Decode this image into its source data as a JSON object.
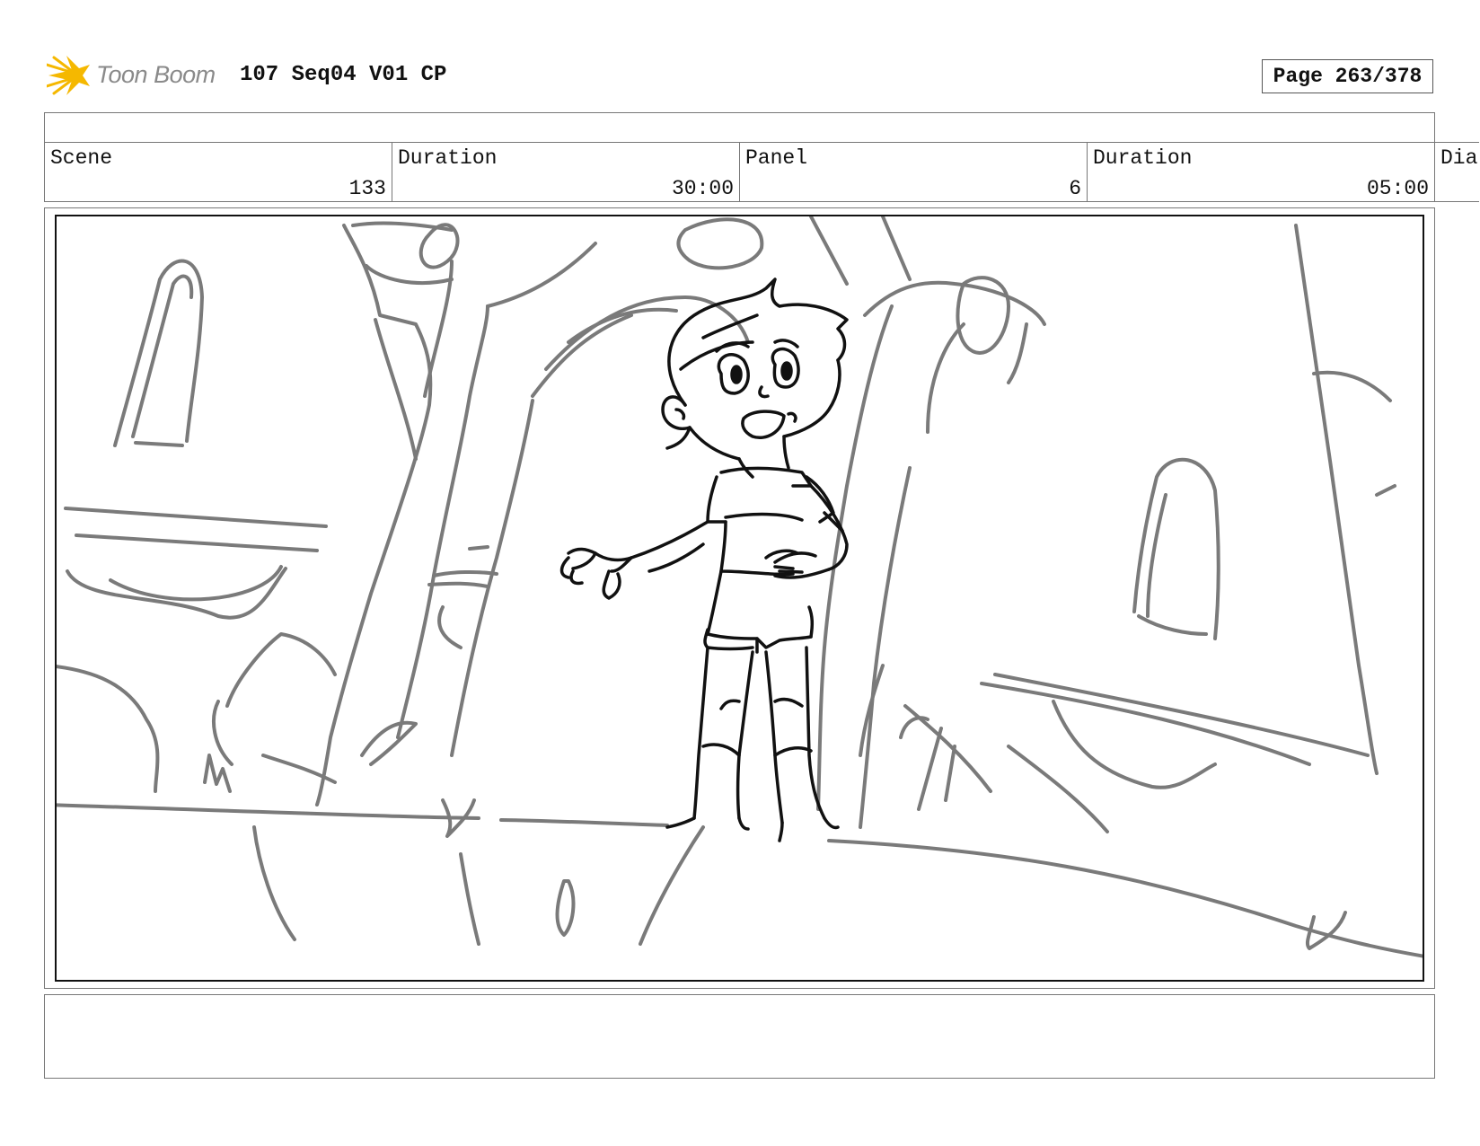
{
  "header": {
    "logo_text": "Toon Boom",
    "title": "107 Seq04 V01 CP",
    "page": "Page 263/378"
  },
  "info": {
    "scene_label": "Scene",
    "scene_value": "133",
    "scene_duration_label": "Duration",
    "scene_duration_value": "30:00",
    "panel_label": "Panel",
    "panel_value": "6",
    "panel_duration_label": "Duration",
    "panel_duration_value": "05:00",
    "dialog_label": "Dia"
  },
  "panel_image": {
    "icon": "storyboard-sketch",
    "description_icon": "rough-pencil-drawing"
  },
  "colors": {
    "logo_star": "#f5b800",
    "logo_text": "#8a8a8a",
    "sketch_background": "#7a7a7a",
    "sketch_character": "#111111"
  }
}
